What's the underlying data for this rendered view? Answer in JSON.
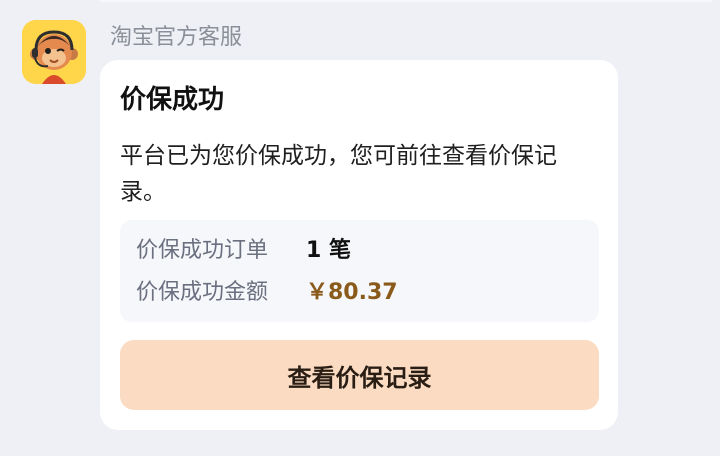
{
  "chat": {
    "sender_name": "淘宝官方客服",
    "avatar_icon": "monkey-mascot-avatar"
  },
  "card": {
    "title": "价保成功",
    "message": "平台已为您价保成功，您可前往查看价保记录。",
    "details": [
      {
        "label": "价保成功订单",
        "value": "1 笔"
      },
      {
        "label": "价保成功金额",
        "value": "￥80.37"
      }
    ],
    "button_label": "查看价保记录"
  },
  "colors": {
    "page_background": "#eef0f5",
    "card_background": "#ffffff",
    "button_background": "#fbdcc3",
    "amount_color": "#8a5a1b",
    "avatar_background": "#ffd54a"
  }
}
